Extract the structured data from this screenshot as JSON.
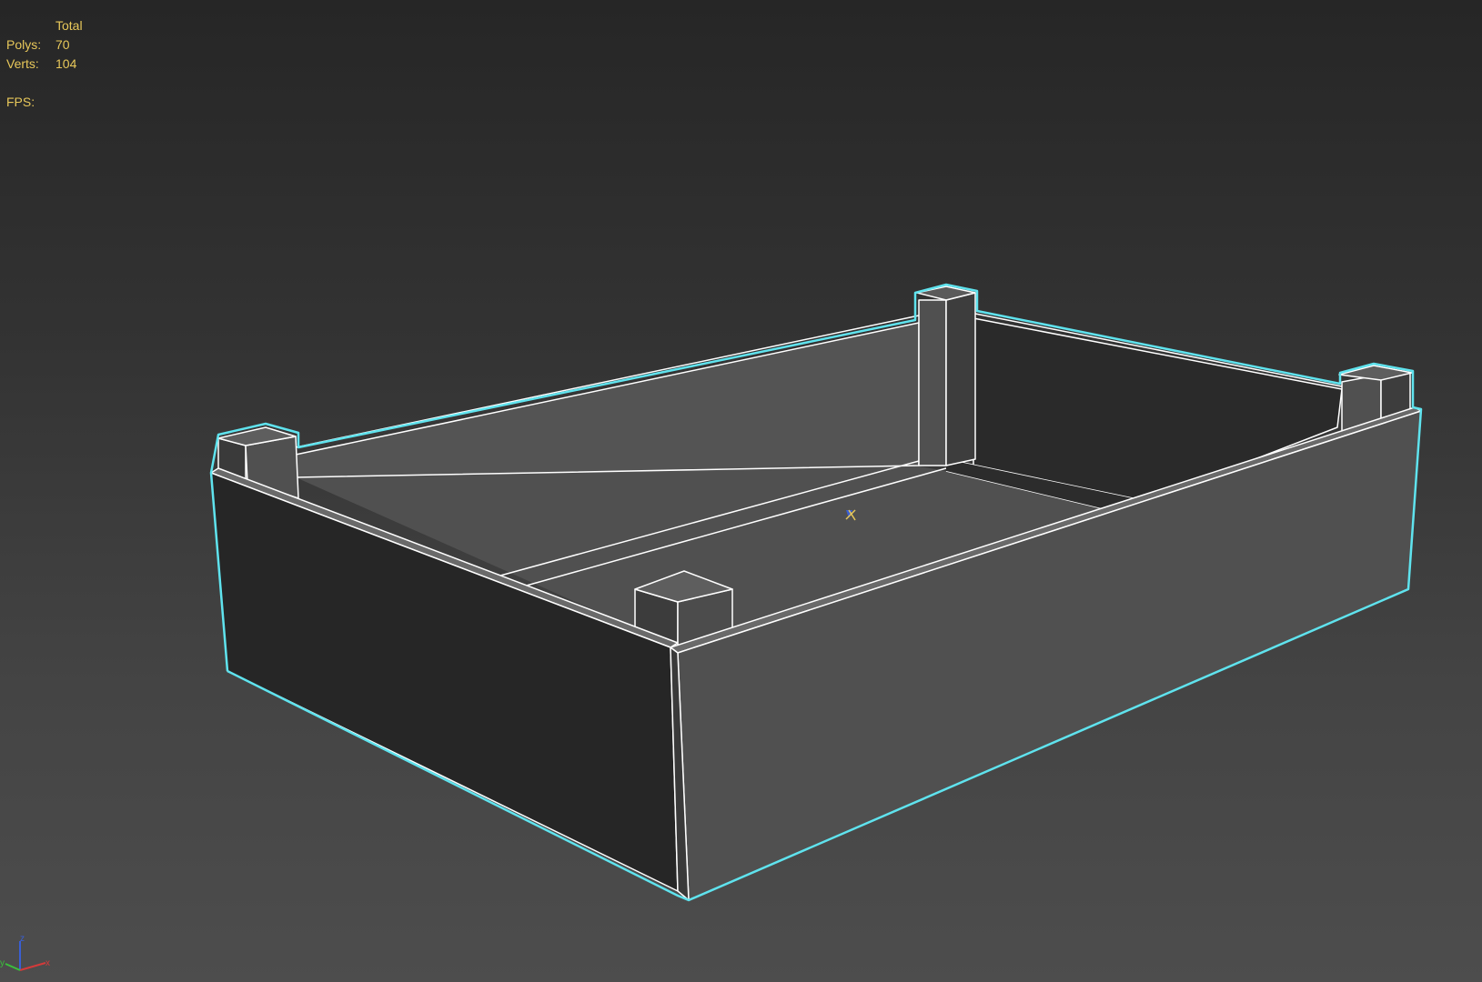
{
  "viewport": {
    "stats": {
      "header": "Total",
      "polys_label": "Polys:",
      "polys_value": "70",
      "verts_label": "Verts:",
      "verts_value": "104",
      "fps_label": "FPS:",
      "fps_value": ""
    },
    "axis_gizmo": {
      "x_label": "x",
      "y_label": "y",
      "z_label": "z"
    },
    "colors": {
      "background_top": "#262626",
      "background_bottom": "#4d4d4d",
      "stats_text": "#e8c85a",
      "selection_outline": "#5fe3ee",
      "wireframe": "#ffffff",
      "axis_x": "#d43a3a",
      "axis_y": "#3bbf3b",
      "axis_z": "#3a5fd4"
    },
    "selected_object": "planter-box"
  }
}
